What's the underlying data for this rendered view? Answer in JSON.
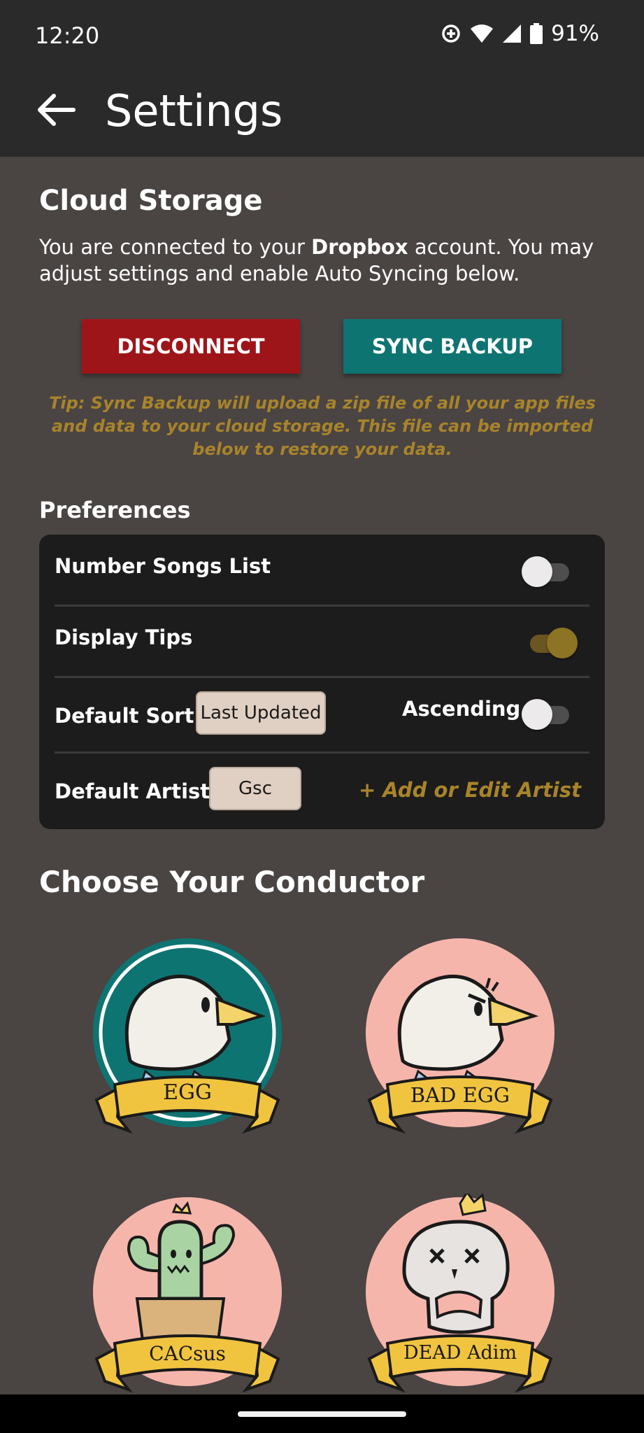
{
  "status": {
    "time": "12:20",
    "battery": "91%"
  },
  "app_bar": {
    "title": "Settings"
  },
  "cloud": {
    "title": "Cloud Storage",
    "desc_prefix": "You are connected to your ",
    "desc_bold": "Dropbox",
    "desc_suffix": " account. You may adjust settings and enable Auto Syncing below.",
    "disconnect_label": "DISCONNECT",
    "sync_label": "SYNC BACKUP",
    "tip": "Tip: Sync Backup will upload a zip file of all your app files and data to your cloud storage. This file can be imported below to restore your data."
  },
  "preferences": {
    "title": "Preferences",
    "number_songs_label": "Number Songs List",
    "number_songs_on": false,
    "display_tips_label": "Display Tips",
    "display_tips_on": true,
    "default_sort_label": "Default Sort:",
    "default_sort_value": "Last Updated",
    "ascending_label": "Ascending",
    "ascending_on": false,
    "default_artist_label": "Default Artist:",
    "default_artist_value": "Gsc",
    "add_artist_label": "+ Add or Edit Artist"
  },
  "conductors": {
    "title": "Choose Your Conductor",
    "items": [
      {
        "name": "EGG",
        "selected": true
      },
      {
        "name": "BAD EGG",
        "selected": false
      },
      {
        "name": "CACsus",
        "selected": false
      },
      {
        "name": "DEAD Adim",
        "selected": false
      }
    ]
  },
  "colors": {
    "background": "#4a4443",
    "bar": "#2b2a2a",
    "disconnect": "#9e1519",
    "sync": "#0e7472",
    "accent_gold": "#a8842a",
    "card": "#1d1c1c",
    "badge_pink": "#f6b5ab",
    "badge_teal": "#0e7472",
    "ribbon": "#f1c440"
  }
}
